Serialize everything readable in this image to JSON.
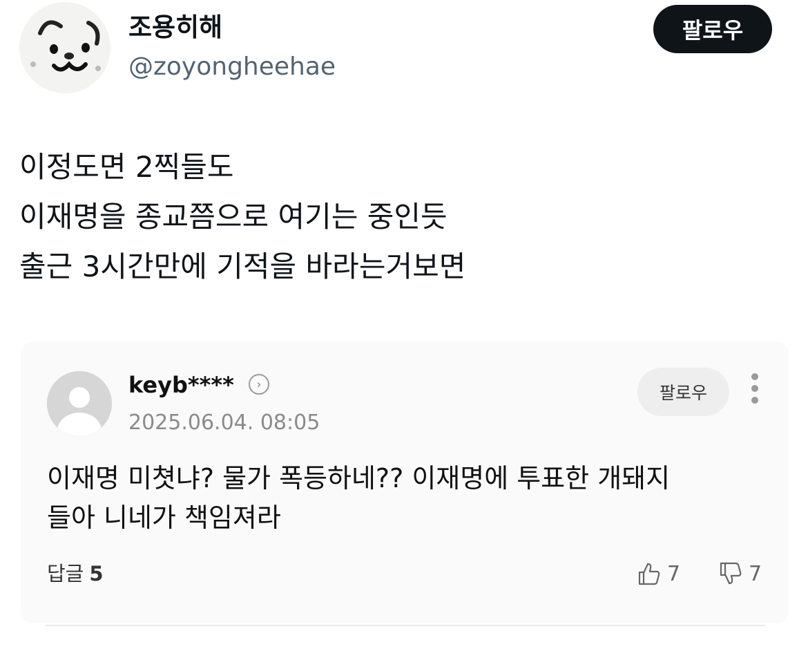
{
  "post": {
    "display_name": "조용히해",
    "handle": "@zoyongheehae",
    "follow_label": "팔로우",
    "lines": [
      "이정도면 2찍들도",
      "이재명을 종교쯤으로 여기는 중인듯",
      "출근 3시간만에 기적을 바라는거보면"
    ]
  },
  "comment": {
    "username": "keyb****",
    "date": "2025.06.04. 08:05",
    "follow_label": "팔로우",
    "lines": [
      "이재명 미쳣냐? 물가 폭등하네?? 이재명에 투표한 개돼지",
      "들아 니네가 책임져라"
    ],
    "reply_label": "답글",
    "reply_count": "5",
    "like_count": "7",
    "dislike_count": "7"
  },
  "icons": {
    "profile": "cat-face-avatar",
    "commenter": "default-user-avatar",
    "profile_link": "chevron-right-icon",
    "more": "more-vertical-icon",
    "like": "thumbs-up-icon",
    "dislike": "thumbs-down-icon"
  },
  "colors": {
    "follow_button": "#0f1419",
    "handle": "#536471",
    "card_background": "#fafafa"
  }
}
